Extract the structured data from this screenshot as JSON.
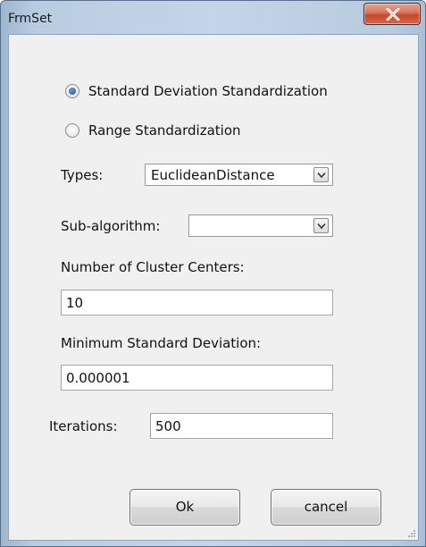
{
  "window": {
    "title": "FrmSet"
  },
  "standardization": {
    "options": [
      {
        "label": "Standard Deviation Standardization",
        "checked": true
      },
      {
        "label": "Range Standardization",
        "checked": false
      }
    ]
  },
  "types": {
    "label": "Types:",
    "value": "EuclideanDistance"
  },
  "sub_algorithm": {
    "label": "Sub-algorithm:",
    "value": ""
  },
  "cluster_centers": {
    "label": "Number of Cluster Centers:",
    "value": "10"
  },
  "min_std_dev": {
    "label": "Minimum Standard Deviation:",
    "value": "0.000001"
  },
  "iterations": {
    "label": "Iterations:",
    "value": "500"
  },
  "buttons": {
    "ok": "Ok",
    "cancel": "cancel"
  },
  "icons": {
    "close": "close-x-icon",
    "dropdown": "chevron-down-icon",
    "resize": "resize-grip-icon"
  }
}
